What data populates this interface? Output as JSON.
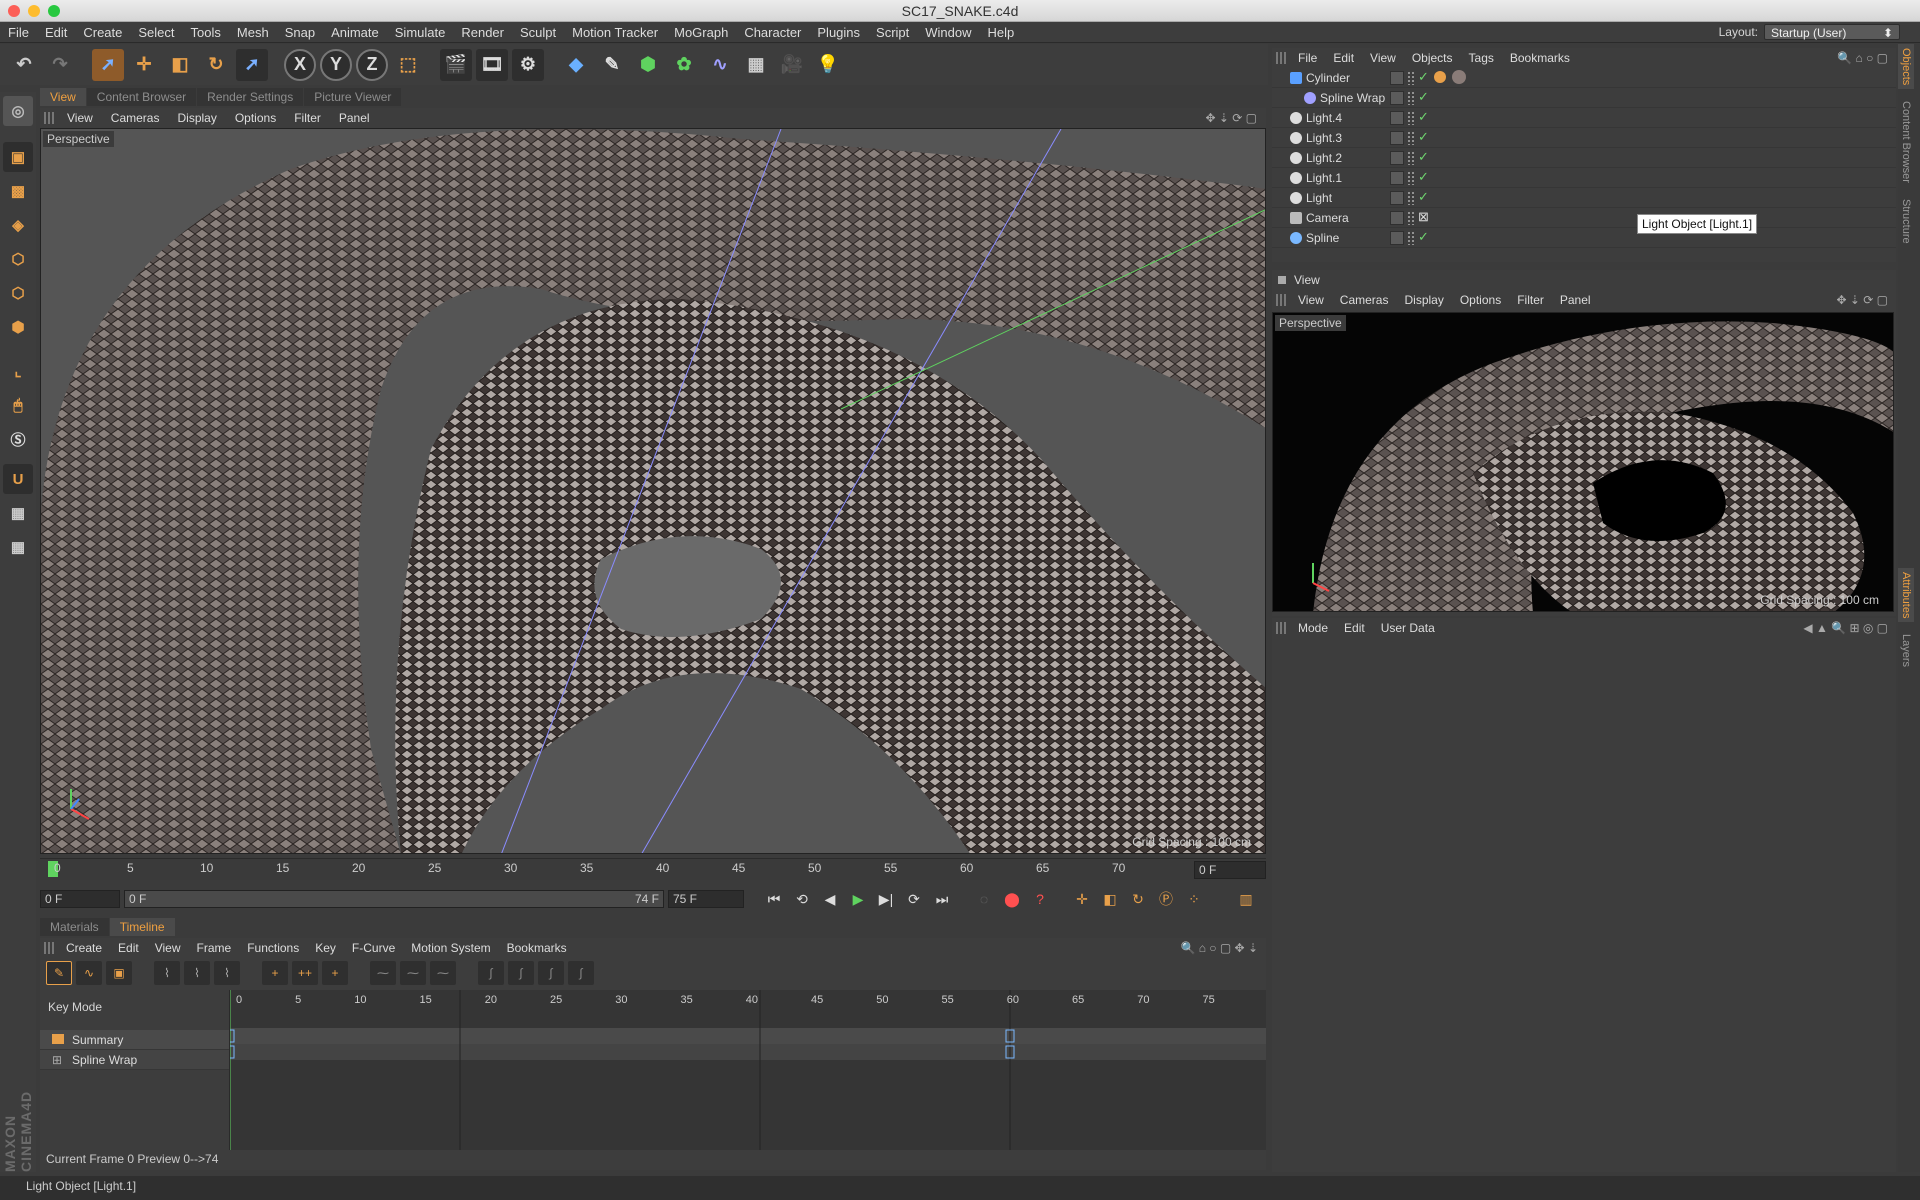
{
  "window": {
    "title": "SC17_SNAKE.c4d"
  },
  "menubar": {
    "items": [
      "File",
      "Edit",
      "Create",
      "Select",
      "Tools",
      "Mesh",
      "Snap",
      "Animate",
      "Simulate",
      "Render",
      "Sculpt",
      "Motion Tracker",
      "MoGraph",
      "Character",
      "Plugins",
      "Script",
      "Window",
      "Help"
    ],
    "layout_label": "Layout:",
    "layout_value": "Startup (User)"
  },
  "toolbar": {
    "icons": [
      "undo-icon",
      "redo-icon",
      "select-icon",
      "move-icon",
      "scale-icon",
      "rotate-icon",
      "live-select-icon",
      "x-axis-icon",
      "y-axis-icon",
      "z-axis-icon",
      "world-coord-icon",
      "render-view-icon",
      "render-picture-viewer-icon",
      "edit-render-settings-icon",
      "cube-icon",
      "pen-icon",
      "subdivision-icon",
      "array-icon",
      "deformer-icon",
      "floor-icon",
      "camera-icon",
      "light-icon"
    ],
    "x_label": "X",
    "y_label": "Y",
    "z_label": "Z"
  },
  "main_tabs": [
    "View",
    "Content Browser",
    "Render Settings",
    "Picture Viewer"
  ],
  "viewport_menu": [
    "View",
    "Cameras",
    "Display",
    "Options",
    "Filter",
    "Panel"
  ],
  "viewport": {
    "label": "Perspective",
    "grid_spacing": "Grid Spacing : 100 cm"
  },
  "ruler": {
    "ticks": [
      "0",
      "5",
      "10",
      "15",
      "20",
      "25",
      "30",
      "35",
      "40",
      "45",
      "50",
      "55",
      "60",
      "65",
      "70"
    ],
    "current": "0 F"
  },
  "transport": {
    "start_field": "0 F",
    "range_start": "0 F",
    "range_end": "74 F",
    "end_field": "75 F"
  },
  "bottom_tabs": [
    "Materials",
    "Timeline"
  ],
  "timeline": {
    "menu": [
      "Create",
      "Edit",
      "View",
      "Frame",
      "Functions",
      "Key",
      "F-Curve",
      "Motion System",
      "Bookmarks"
    ],
    "key_mode": "Key Mode",
    "tracks": [
      "Summary",
      "Spline Wrap"
    ],
    "ticks": [
      "0",
      "5",
      "10",
      "15",
      "20",
      "25",
      "30",
      "35",
      "40",
      "45",
      "50",
      "55",
      "60",
      "65",
      "70",
      "75"
    ],
    "footer": "Current Frame  0  Preview  0-->74"
  },
  "objects_panel": {
    "menu": [
      "File",
      "Edit",
      "View",
      "Objects",
      "Tags",
      "Bookmarks"
    ],
    "rows": [
      "Cylinder",
      "Spline Wrap",
      "Light.4",
      "Light.3",
      "Light.2",
      "Light.1",
      "Light",
      "Camera",
      "Spline"
    ]
  },
  "tooltip": "Light Object [Light.1]",
  "view_panel": {
    "title": "View",
    "menu": [
      "View",
      "Cameras",
      "Display",
      "Options",
      "Filter",
      "Panel"
    ],
    "label": "Perspective",
    "grid_spacing": "Grid Spacing : 100 cm"
  },
  "attributes_panel": {
    "menu": [
      "Mode",
      "Edit",
      "User Data"
    ]
  },
  "right_tabs": [
    "Objects",
    "Content Browser",
    "Structure",
    "Attributes",
    "Layers"
  ],
  "status": "Light Object [Light.1]",
  "brand": "MAXON CINEMA4D",
  "colors": {
    "accent": "#f0a040",
    "check": "#6fd56f",
    "playhead": "#5fd35f"
  }
}
